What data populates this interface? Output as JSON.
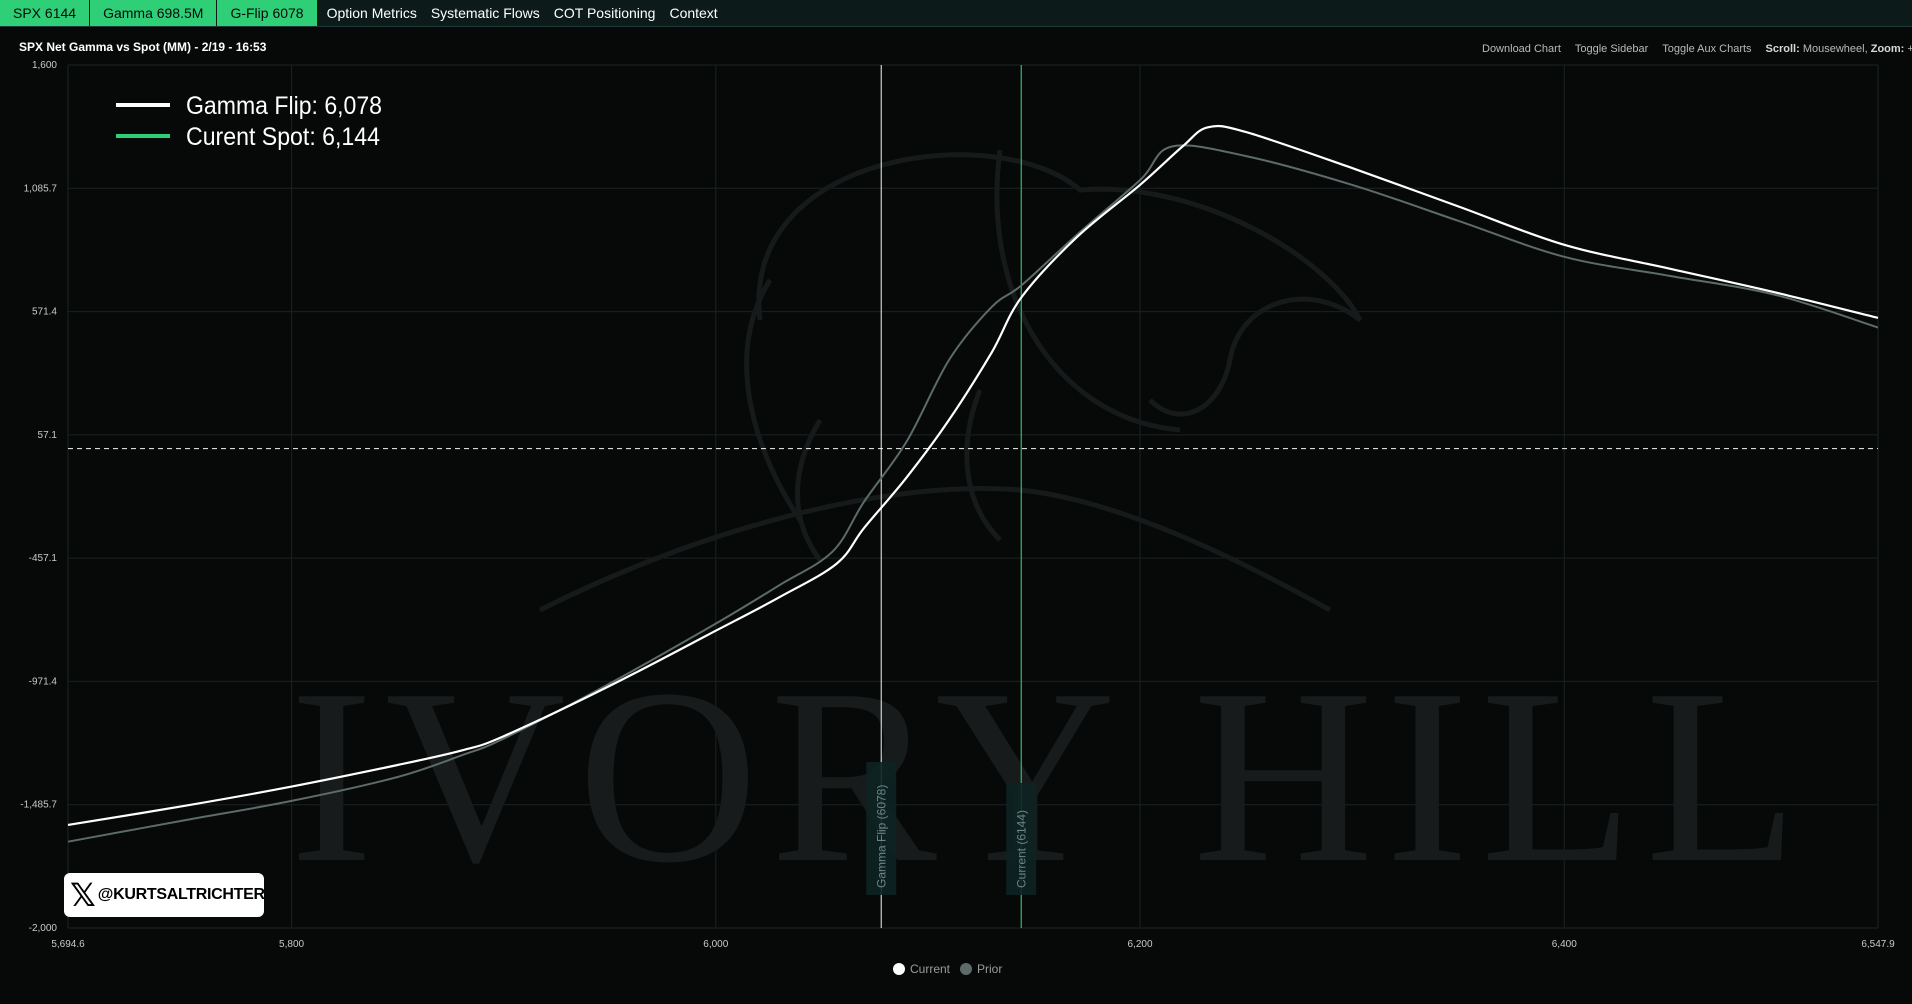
{
  "topnav": {
    "badges": [
      "SPX 6144",
      "Gamma 698.5M",
      "G-Flip 6078"
    ],
    "menu": [
      "Option Metrics",
      "Systematic Flows",
      "COT Positioning",
      "Context"
    ]
  },
  "chart_title": "SPX Net Gamma vs Spot (MM) - 2/19 - 16:53",
  "toolbar": {
    "download": "Download Chart",
    "sidebar": "Toggle Sidebar",
    "aux": "Toggle Aux Charts",
    "scroll_label": "Scroll:",
    "scroll_value": "Mousewheel,",
    "zoom_label": "Zoom:",
    "zoom_value": "+/-"
  },
  "watermark": "IVORY HILL",
  "x_handle": "@KURTSALTRICHTER",
  "colors": {
    "current": "#ffffff",
    "prior": "#5d6b6b",
    "spot_line": "#2fcf78",
    "badge": "#2fcf78",
    "gridline": "#1b2222"
  },
  "chart_data": {
    "type": "line",
    "title": "SPX Net Gamma vs Spot (MM) - 2/19 - 16:53",
    "xlim": [
      5694.6,
      6547.9
    ],
    "ylim": [
      -2000,
      1600
    ],
    "xticks": [
      5694.6,
      5800,
      6000,
      6200,
      6400,
      6547.9
    ],
    "xtick_labels": [
      "5,694.6",
      "5,800",
      "6,000",
      "6,200",
      "6,400",
      "6,547.9"
    ],
    "yticks": [
      1600,
      1085.7,
      571.4,
      57.1,
      -457.1,
      -971.4,
      -1485.7,
      -2000
    ],
    "ytick_labels": [
      "1,600",
      "1,085.7",
      "571.4",
      "57.1",
      "-457.1",
      "-971.4",
      "-1,485.7",
      "-2,000"
    ],
    "zero_line": 0,
    "grid": true,
    "legend_labels": [
      "Current",
      "Prior"
    ],
    "legend_position": "bottom",
    "annotations": [
      {
        "label": "Gamma Flip: 6,078",
        "x": 6078,
        "vline_label": "Gamma Flip (6078)"
      },
      {
        "label": "Curent Spot: 6,144",
        "x": 6144,
        "vline_label": "Current (6144)"
      }
    ],
    "series": [
      {
        "name": "Current",
        "x": [
          5694.6,
          5750,
          5800,
          5850,
          5880,
          5900,
          5950,
          6000,
          6030,
          6057,
          6070,
          6090,
          6110,
          6130,
          6144,
          6170,
          6200,
          6220,
          6232,
          6250,
          6300,
          6350,
          6400,
          6450,
          6500,
          6547.9
        ],
        "y": [
          -1570,
          -1490,
          -1410,
          -1320,
          -1260,
          -1200,
          -990,
          -760,
          -620,
          -480,
          -330,
          -120,
          120,
          400,
          630,
          880,
          1100,
          1260,
          1340,
          1320,
          1170,
          1010,
          850,
          750,
          650,
          545
        ]
      },
      {
        "name": "Prior",
        "x": [
          5694.6,
          5750,
          5800,
          5850,
          5880,
          5900,
          5950,
          6000,
          6030,
          6055,
          6070,
          6090,
          6110,
          6130,
          6144,
          6170,
          6200,
          6215,
          6250,
          6300,
          6350,
          6400,
          6450,
          6500,
          6547.9
        ],
        "y": [
          -1640,
          -1550,
          -1470,
          -1370,
          -1280,
          -1210,
          -980,
          -730,
          -570,
          -430,
          -220,
          30,
          370,
          590,
          680,
          890,
          1120,
          1260,
          1220,
          1100,
          950,
          800,
          720,
          640,
          505
        ]
      }
    ]
  }
}
